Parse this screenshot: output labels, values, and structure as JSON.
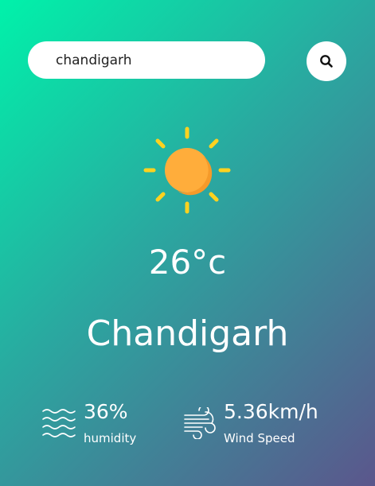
{
  "search": {
    "value": "chandigarh",
    "button_icon": "search-icon"
  },
  "weather": {
    "icon": "sun-icon",
    "temperature": "26°c",
    "city": "Chandigarh"
  },
  "details": {
    "humidity": {
      "icon": "humidity-waves-icon",
      "value": "36%",
      "label": "humidity"
    },
    "wind": {
      "icon": "wind-icon",
      "value": "5.36km/h",
      "label": "Wind Speed"
    }
  },
  "colors": {
    "gradient_start": "#00f2aa",
    "gradient_mid": "#2aa8a0",
    "gradient_end": "#5b568c",
    "sun_body": "#ffad3b",
    "sun_rays": "#ffd21f",
    "text": "#ffffff"
  }
}
